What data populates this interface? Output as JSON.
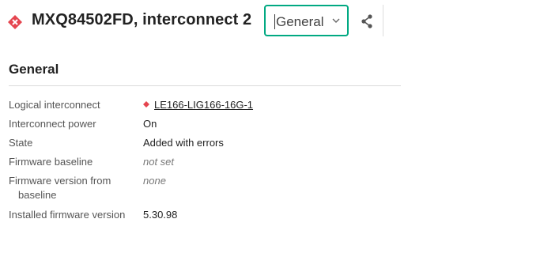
{
  "header": {
    "title": "MXQ84502FD, interconnect 2",
    "status_icon": "critical-diamond-icon",
    "status_color": "#e5454f",
    "view_select": {
      "value": "General",
      "border_color": "#01a982"
    },
    "share_icon": "share-icon"
  },
  "section": {
    "title": "General",
    "rows": [
      {
        "label": "Logical interconnect",
        "value": "LE166-LIG166-16G-1",
        "value_icon": "critical-diamond-icon"
      },
      {
        "label": "Interconnect power",
        "value": "On"
      },
      {
        "label": "State",
        "value": "Added with errors"
      },
      {
        "label": "Firmware baseline",
        "value": "not set"
      },
      {
        "label": "Firmware version from baseline",
        "value": "none"
      },
      {
        "label": "Installed firmware version",
        "value": "5.30.98"
      }
    ]
  }
}
